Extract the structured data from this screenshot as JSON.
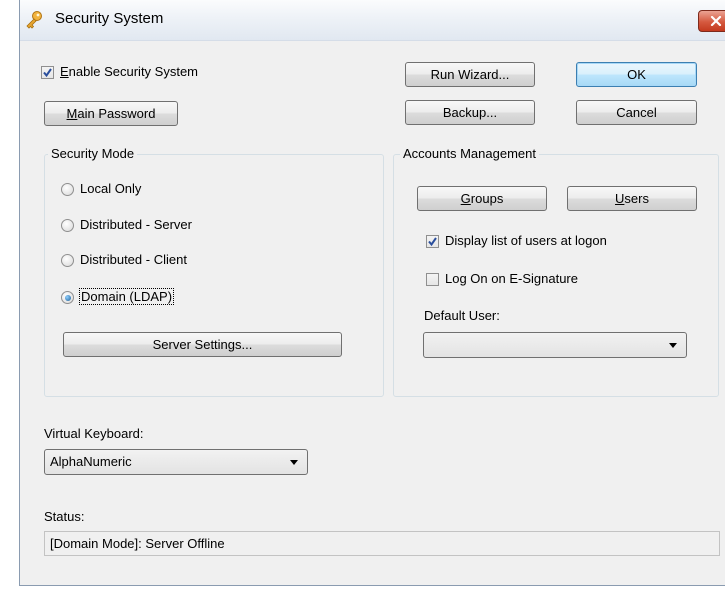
{
  "window": {
    "title": "Security System",
    "icon": "key-icon",
    "close_icon": "close-icon",
    "close_color": "#c43a1f"
  },
  "enable_security": {
    "label_mnemonic": "E",
    "label_rest": "nable Security System",
    "checked": true
  },
  "buttons": {
    "main_password_mnemonic": "M",
    "main_password_rest": "ain Password",
    "run_wizard": "Run Wizard...",
    "backup": "Backup...",
    "ok": "OK",
    "cancel": "Cancel",
    "server_settings": "Server Settings...",
    "groups_mnemonic": "G",
    "groups_rest": "roups",
    "users_mnemonic": "U",
    "users_rest": "sers"
  },
  "security_mode": {
    "legend": "Security Mode",
    "options": [
      {
        "label": "Local Only",
        "selected": false
      },
      {
        "label": "Distributed - Server",
        "selected": false
      },
      {
        "label": "Distributed - Client",
        "selected": false
      },
      {
        "label": "Domain (LDAP)",
        "selected": true
      }
    ]
  },
  "accounts": {
    "legend": "Accounts Management",
    "display_users_label": "Display list of users at logon",
    "display_users_checked": true,
    "logon_esig_label": "Log On on E-Signature",
    "logon_esig_checked": false,
    "default_user_label": "Default User:",
    "default_user_value": ""
  },
  "virtual_keyboard": {
    "label": "Virtual Keyboard:",
    "value": "AlphaNumeric"
  },
  "status": {
    "label": "Status:",
    "value": "[Domain Mode]: Server Offline"
  },
  "colors": {
    "dialog_bg": "#f0f0f0",
    "default_button_border": "#3c7fb1",
    "checkmark": "#2a4e9c"
  }
}
